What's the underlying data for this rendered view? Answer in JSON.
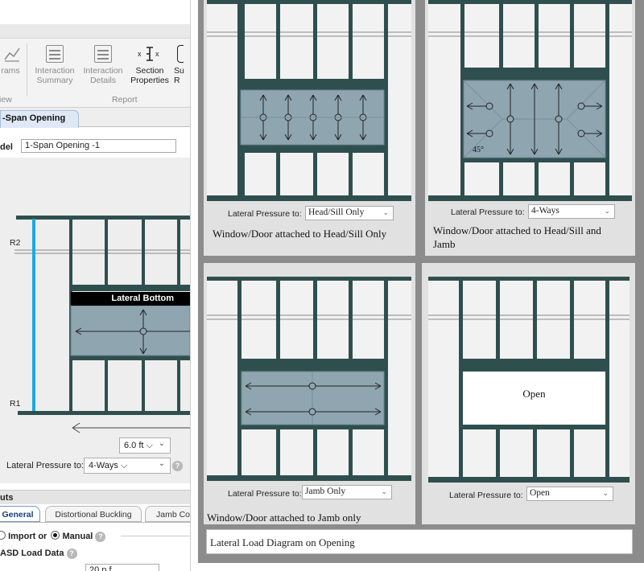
{
  "ribbon": {
    "buttons": [
      {
        "line1": "",
        "line2": "rams"
      },
      {
        "line1": "Interaction",
        "line2": "Summary"
      },
      {
        "line1": "Interaction",
        "line2": "Details"
      },
      {
        "line1": "Section",
        "line2": "Properties"
      },
      {
        "line1": "Su",
        "line2": "R"
      }
    ],
    "group_view": "iew",
    "group_report": "Report"
  },
  "doc_tab": "-Span Opening",
  "model": {
    "label": "del",
    "value": "1-Span Opening -1"
  },
  "left_diagram": {
    "r2": "R2",
    "r1": "R1",
    "lateral_bottom": "Lateral Bottom",
    "span_value": "6.0 ft",
    "lateral_pressure_label": "Lateral Pressure to:",
    "lateral_pressure_value": "4-Ways"
  },
  "inputs": {
    "header": "uts",
    "tabs": [
      "General",
      "Distortional Buckling",
      "Jamb Co"
    ],
    "import_label": "Import or",
    "manual_label": "Manual",
    "asd_label": "ASD Load Data",
    "partial_value": "20 p f"
  },
  "panels": [
    {
      "label": "Lateral Pressure to:",
      "value": "Head/Sill Only",
      "caption": "Window/Door attached to Head/Sill Only"
    },
    {
      "label": "Lateral Pressure to:",
      "value": "4-Ways",
      "caption_line1": "Window/Door attached to Head/Sill and",
      "caption_line2": "Jamb",
      "angle": "45°"
    },
    {
      "label": "Lateral Pressure to:",
      "value": "Jamb Only",
      "caption": "Window/Door attached to Jamb only"
    },
    {
      "label": "Lateral Pressure to:",
      "value": "Open",
      "open_text": "Open"
    }
  ],
  "bottom_caption": "Lateral Load Diagram on Opening",
  "colors": {
    "frame": "#2f4f4f",
    "opening": "#8fa6b1",
    "blue_line": "#1fa8e0",
    "panel_bg": "#e1e1e1",
    "border_grey": "#8c8c8c"
  },
  "icons": [
    "chart-icon",
    "interaction-summary-icon",
    "interaction-details-icon",
    "section-properties-icon",
    "help-icon",
    "chevron-down-icon"
  ]
}
